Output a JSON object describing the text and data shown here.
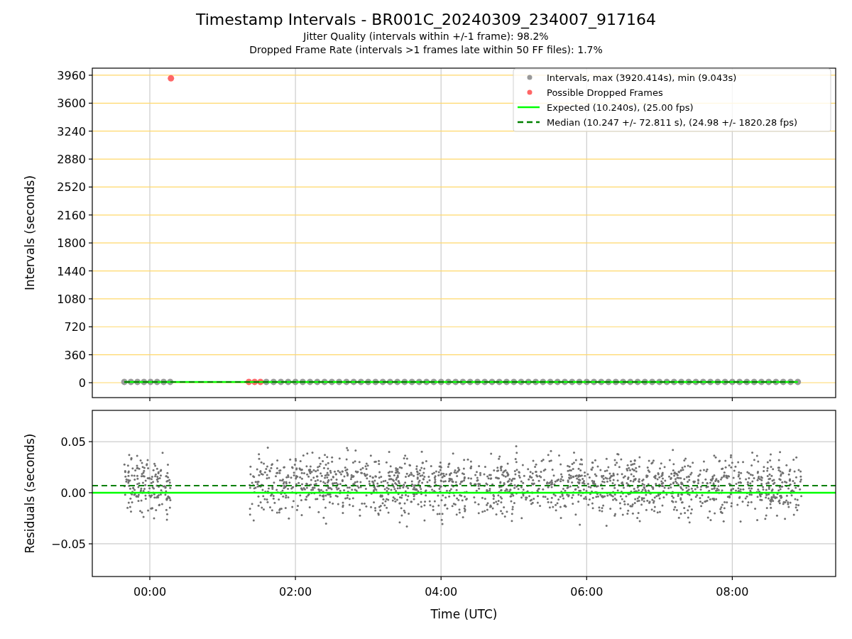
{
  "figure": {
    "title": "Timestamp Intervals - BR001C_20240309_234007_917164",
    "subtitles": [
      "Jitter Quality (intervals within +/-1 frame): 98.2%",
      "Dropped Frame Rate (intervals >1 frames late within 50 FF files): 1.7%"
    ]
  },
  "intervals_plot": {
    "chart_data": {
      "type": "scatter",
      "ylabel": "Intervals (seconds)",
      "grid": true,
      "legend": true,
      "x": [
        -0.35,
        -0.26,
        -0.17,
        -0.08,
        0.01,
        0.1,
        0.19,
        0.28,
        0.29,
        1.36,
        1.44,
        1.52,
        1.6,
        1.7,
        1.8,
        1.9,
        2,
        2.1,
        2.2,
        2.3,
        2.4,
        2.5,
        2.6,
        2.7,
        2.8,
        2.9,
        3,
        3.1,
        3.2,
        3.3,
        3.4,
        3.5,
        3.6,
        3.7,
        3.8,
        3.9,
        4,
        4.1,
        4.2,
        4.3,
        4.4,
        4.5,
        4.6,
        4.7,
        4.8,
        4.9,
        5,
        5.1,
        5.2,
        5.3,
        5.4,
        5.5,
        5.6,
        5.7,
        5.8,
        5.9,
        6,
        6.1,
        6.2,
        6.3,
        6.4,
        6.5,
        6.6,
        6.7,
        6.8,
        6.9,
        7,
        7.1,
        7.2,
        7.3,
        7.4,
        7.5,
        7.6,
        7.7,
        7.8,
        7.9,
        8,
        8.1,
        8.2,
        8.3,
        8.4,
        8.5,
        8.6,
        8.7,
        8.8,
        8.9
      ],
      "xlim": [
        -0.79,
        9.42
      ],
      "ylim": [
        -192,
        4051
      ],
      "yticks": [
        {
          "value": 0,
          "label": "0"
        },
        {
          "value": 360,
          "label": "360"
        },
        {
          "value": 720,
          "label": "720"
        },
        {
          "value": 1080,
          "label": "1080"
        },
        {
          "value": 1440,
          "label": "1440"
        },
        {
          "value": 1800,
          "label": "1800"
        },
        {
          "value": 2160,
          "label": "2160"
        },
        {
          "value": 2520,
          "label": "2520"
        },
        {
          "value": 2880,
          "label": "2880"
        },
        {
          "value": 3240,
          "label": "3240"
        },
        {
          "value": 3600,
          "label": "3600"
        },
        {
          "value": 3960,
          "label": "3960"
        }
      ],
      "series": [
        {
          "name": "Intervals, max (3920.414s), min (9.043s)",
          "color": "#999999",
          "type": "scatter",
          "values": [
            10,
            10,
            10,
            10,
            10,
            10,
            10,
            10,
            null,
            null,
            null,
            null,
            10,
            10,
            10,
            10,
            10,
            10,
            10,
            10,
            10,
            10,
            10,
            10,
            10,
            10,
            10,
            10,
            10,
            10,
            10,
            10,
            10,
            10,
            10,
            10,
            10,
            10,
            10,
            10,
            10,
            10,
            10,
            10,
            10,
            10,
            10,
            10,
            10,
            10,
            10,
            10,
            10,
            10,
            10,
            10,
            10,
            10,
            10,
            10,
            10,
            10,
            10,
            10,
            10,
            10,
            10,
            10,
            10,
            10,
            10,
            10,
            10,
            10,
            10,
            10,
            10,
            10,
            10,
            10,
            10,
            10,
            10,
            10,
            10,
            10
          ]
        },
        {
          "name": "Possible Dropped Frames",
          "color": "#ff6666",
          "type": "scatter",
          "values": [
            null,
            null,
            null,
            null,
            null,
            null,
            null,
            null,
            3920,
            10,
            10,
            10,
            null,
            null,
            null,
            null,
            null,
            null,
            null,
            null,
            null,
            null,
            null,
            null,
            null,
            null,
            null,
            null,
            null,
            null,
            null,
            null,
            null,
            null,
            null,
            null,
            null,
            null,
            null,
            null,
            null,
            null,
            null,
            null,
            null,
            null,
            null,
            null,
            null,
            null,
            null,
            null,
            null,
            null,
            null,
            null,
            null,
            null,
            null,
            null,
            null,
            null,
            null,
            null,
            null,
            null,
            null,
            null,
            null,
            null,
            null,
            null,
            null,
            null,
            null,
            null,
            null,
            null,
            null,
            null,
            null,
            null,
            null,
            null,
            null,
            null
          ]
        },
        {
          "name": "Expected (10.240s), (25.00 fps)",
          "color": "#00ff00",
          "type": "line",
          "line_style": "solid",
          "values": [
            10,
            10,
            10,
            10,
            10,
            10,
            10,
            10,
            10,
            10,
            10,
            10,
            10,
            10,
            10,
            10,
            10,
            10,
            10,
            10,
            10,
            10,
            10,
            10,
            10,
            10,
            10,
            10,
            10,
            10,
            10,
            10,
            10,
            10,
            10,
            10,
            10,
            10,
            10,
            10,
            10,
            10,
            10,
            10,
            10,
            10,
            10,
            10,
            10,
            10,
            10,
            10,
            10,
            10,
            10,
            10,
            10,
            10,
            10,
            10,
            10,
            10,
            10,
            10,
            10,
            10,
            10,
            10,
            10,
            10,
            10,
            10,
            10,
            10,
            10,
            10,
            10,
            10,
            10,
            10,
            10,
            10,
            10,
            10,
            10,
            10
          ]
        },
        {
          "name": "Median (10.247 +/- 72.811 s), (24.98 +/- 1820.28 fps)",
          "color": "#008000",
          "type": "line",
          "line_style": "dashed",
          "values": [
            10,
            10,
            10,
            10,
            10,
            10,
            10,
            10,
            10,
            10,
            10,
            10,
            10,
            10,
            10,
            10,
            10,
            10,
            10,
            10,
            10,
            10,
            10,
            10,
            10,
            10,
            10,
            10,
            10,
            10,
            10,
            10,
            10,
            10,
            10,
            10,
            10,
            10,
            10,
            10,
            10,
            10,
            10,
            10,
            10,
            10,
            10,
            10,
            10,
            10,
            10,
            10,
            10,
            10,
            10,
            10,
            10,
            10,
            10,
            10,
            10,
            10,
            10,
            10,
            10,
            10,
            10,
            10,
            10,
            10,
            10,
            10,
            10,
            10,
            10,
            10,
            10,
            10,
            10,
            10,
            10,
            10,
            10,
            10,
            10,
            10
          ]
        }
      ]
    }
  },
  "residuals_plot": {
    "chart_data": {
      "type": "line",
      "xlabel": "Time (UTC)",
      "ylabel": "Residuals (seconds)",
      "grid": true,
      "x": [
        -0.79,
        9.42
      ],
      "xlim": [
        -0.79,
        9.42
      ],
      "ylim": [
        -0.082,
        0.0806
      ],
      "xticks": [
        {
          "value": 0,
          "label": "00:00"
        },
        {
          "value": 2,
          "label": "02:00"
        },
        {
          "value": 4,
          "label": "04:00"
        },
        {
          "value": 6,
          "label": "06:00"
        },
        {
          "value": 8,
          "label": "08:00"
        }
      ],
      "yticks": [
        {
          "value": -0.05,
          "label": "−0.05"
        },
        {
          "value": 0,
          "label": "0.00"
        },
        {
          "value": 0.05,
          "label": "0.05"
        }
      ],
      "series": [
        {
          "color": "#00ff00",
          "line_style": "solid",
          "values": [
            0,
            0
          ]
        },
        {
          "color": "#008000",
          "line_style": "dashed",
          "values": [
            0.007,
            0.007
          ]
        }
      ]
    }
  }
}
